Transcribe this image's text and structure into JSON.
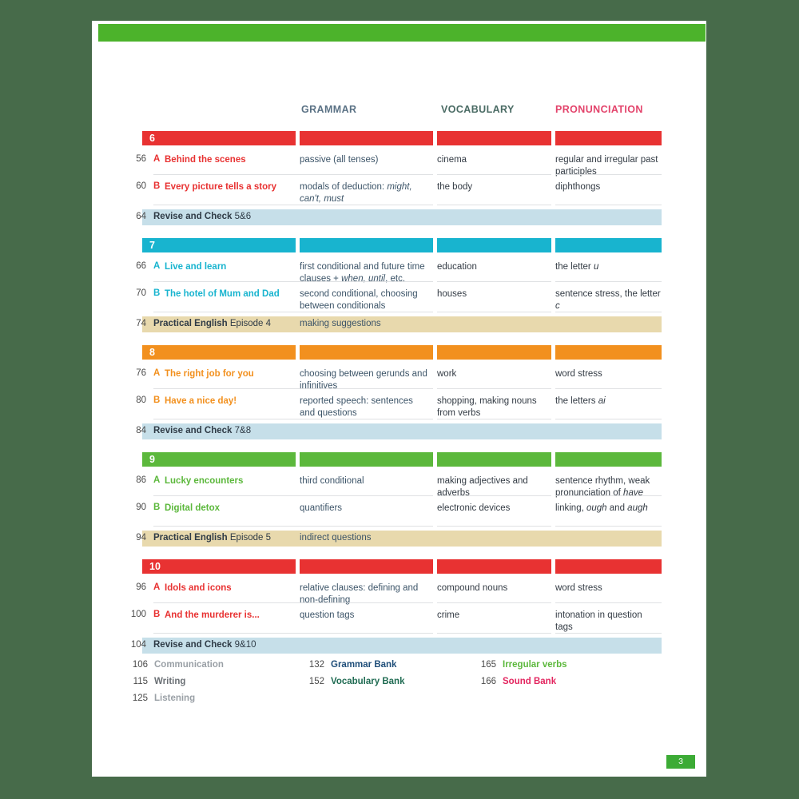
{
  "page": {
    "background_color": "#476b4a",
    "paper_color": "#ffffff",
    "top_bar_color": "#4cb32b",
    "page_badge": "3",
    "page_badge_color": "#3cab35"
  },
  "columns": {
    "grammar": "GRAMMAR",
    "vocabulary": "VOCABULARY",
    "pronunciation": "PRONUNCIATION",
    "grammar_color": "#5b7285",
    "vocabulary_color": "#4a6b64",
    "pronunciation_color": "#e3436b"
  },
  "units": [
    {
      "number": "6",
      "color": "#e83232",
      "lessons": [
        {
          "page": "56",
          "letter": "A",
          "title": "Behind the scenes",
          "grammar": "passive (all tenses)",
          "vocabulary": "cinema",
          "pronunciation": "regular and irregular past participles"
        },
        {
          "page": "60",
          "letter": "B",
          "title": "Every picture tells a story",
          "grammar": "modals of deduction: <i>might, can't, must</i>",
          "vocabulary": "the body",
          "pronunciation": "diphthongs"
        }
      ],
      "banner": {
        "type": "revise",
        "page": "64",
        "bold_label": "Revise and Check",
        "rest_label": " 5&6",
        "extra": "",
        "color": "#c6dfe9"
      }
    },
    {
      "number": "7",
      "color": "#18b4cf",
      "lessons": [
        {
          "page": "66",
          "letter": "A",
          "title": "Live and learn",
          "grammar": "first conditional and future time clauses + <i>when, until</i>, etc.",
          "vocabulary": "education",
          "pronunciation": "the letter <i>u</i>"
        },
        {
          "page": "70",
          "letter": "B",
          "title": "The hotel of Mum and Dad",
          "grammar": "second conditional, choosing between conditionals",
          "vocabulary": "houses",
          "pronunciation": "sentence stress, the letter <i>c</i>"
        }
      ],
      "banner": {
        "type": "practical",
        "page": "74",
        "bold_label": "Practical English",
        "rest_label": " Episode 4",
        "extra": "making suggestions",
        "color": "#e8d9ad"
      }
    },
    {
      "number": "8",
      "color": "#f2901e",
      "lessons": [
        {
          "page": "76",
          "letter": "A",
          "title": "The right job for you",
          "grammar": "choosing between gerunds and infinitives",
          "vocabulary": "work",
          "pronunciation": "word stress"
        },
        {
          "page": "80",
          "letter": "B",
          "title": "Have a nice day!",
          "grammar": "reported speech: sentences and questions",
          "vocabulary": "shopping, making nouns from verbs",
          "pronunciation": "the letters <i>ai</i>"
        }
      ],
      "banner": {
        "type": "revise",
        "page": "84",
        "bold_label": "Revise and Check",
        "rest_label": " 7&8",
        "extra": "",
        "color": "#c6dfe9"
      }
    },
    {
      "number": "9",
      "color": "#5cb83c",
      "lessons": [
        {
          "page": "86",
          "letter": "A",
          "title": "Lucky encounters",
          "grammar": "third conditional",
          "vocabulary": "making adjectives and adverbs",
          "pronunciation": "sentence rhythm, weak pronunciation of <i>have</i>"
        },
        {
          "page": "90",
          "letter": "B",
          "title": "Digital detox",
          "grammar": "quantifiers",
          "vocabulary": "electronic devices",
          "pronunciation": "linking, <i>ough</i> and <i>augh</i>"
        }
      ],
      "banner": {
        "type": "practical",
        "page": "94",
        "bold_label": "Practical English",
        "rest_label": " Episode 5",
        "extra": "indirect questions",
        "color": "#e8d9ad"
      }
    },
    {
      "number": "10",
      "color": "#e83232",
      "lessons": [
        {
          "page": "96",
          "letter": "A",
          "title": "Idols and icons",
          "grammar": "relative clauses: defining and non-defining",
          "vocabulary": "compound nouns",
          "pronunciation": "word stress"
        },
        {
          "page": "100",
          "letter": "B",
          "title": "And the murderer is...",
          "grammar": "question tags",
          "vocabulary": "crime",
          "pronunciation": "intonation in question tags"
        }
      ],
      "banner": {
        "type": "revise",
        "page": "104",
        "bold_label": "Revise and Check",
        "rest_label": " 9&10",
        "extra": "",
        "color": "#c6dfe9"
      }
    }
  ],
  "footer": {
    "column1": [
      {
        "page": "106",
        "label": "Communication",
        "color": "#9aa0a6"
      },
      {
        "page": "115",
        "label": "Writing",
        "color": "#6b7075"
      },
      {
        "page": "125",
        "label": "Listening",
        "color": "#9aa0a6"
      }
    ],
    "column2": [
      {
        "page": "132",
        "label": "Grammar Bank",
        "color": "#1f4e79"
      },
      {
        "page": "152",
        "label": "Vocabulary Bank",
        "color": "#1f6b52"
      }
    ],
    "column3": [
      {
        "page": "165",
        "label": "Irregular verbs",
        "color": "#5cb83c"
      },
      {
        "page": "166",
        "label": "Sound Bank",
        "color": "#e3255f"
      }
    ]
  }
}
